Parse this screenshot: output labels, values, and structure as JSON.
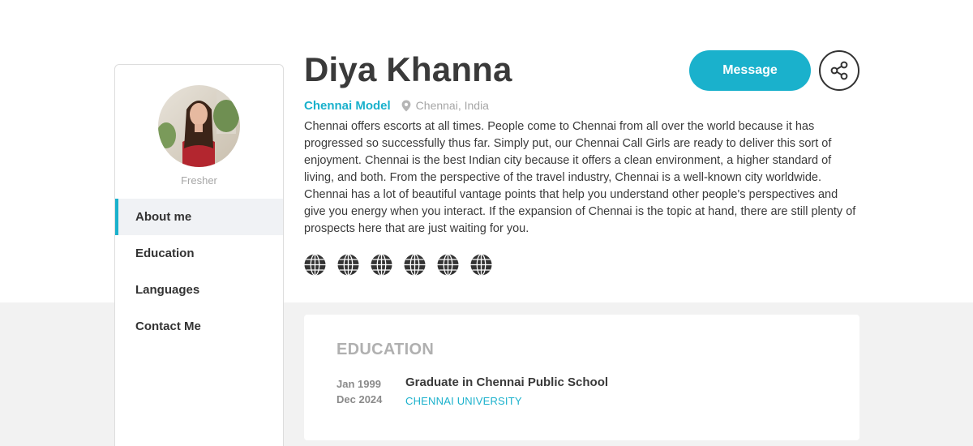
{
  "profile": {
    "name": "Diya Khanna",
    "role": "Chennai Model",
    "location": "Chennai, India",
    "status": "Fresher",
    "bio": "Chennai offers escorts at all times. People come to Chennai from all over the world because it has progressed so successfully thus far. Simply put, our Chennai Call Girls are ready to deliver this sort of enjoyment. Chennai is the best Indian city because it offers a clean environment, a higher standard of living, and both. From the perspective of the travel industry, Chennai is a well-known city worldwide. Chennai has a lot of beautiful vantage points that help you understand other people's perspectives and give you energy when you interact. If the expansion of Chennai is the topic at hand, there are still plenty of prospects here that are just waiting for you."
  },
  "actions": {
    "message_label": "Message",
    "share_icon": "share-icon"
  },
  "sidebar": {
    "items": [
      {
        "label": "About me",
        "active": true
      },
      {
        "label": "Education",
        "active": false
      },
      {
        "label": "Languages",
        "active": false
      },
      {
        "label": "Contact Me",
        "active": false
      }
    ]
  },
  "socials": {
    "icons": [
      "globe-icon",
      "globe-icon",
      "globe-icon",
      "globe-icon",
      "globe-icon",
      "globe-icon"
    ]
  },
  "education": {
    "title": "EDUCATION",
    "entries": [
      {
        "start": "Jan 1999",
        "end": "Dec 2024",
        "degree": "Graduate in Chennai Public School",
        "school": "CHENNAI UNIVERSITY"
      }
    ]
  },
  "colors": {
    "accent": "#1ab1cc",
    "text": "#3a3a3a",
    "muted": "#a6a6a6",
    "background_lower": "#f2f2f2"
  }
}
